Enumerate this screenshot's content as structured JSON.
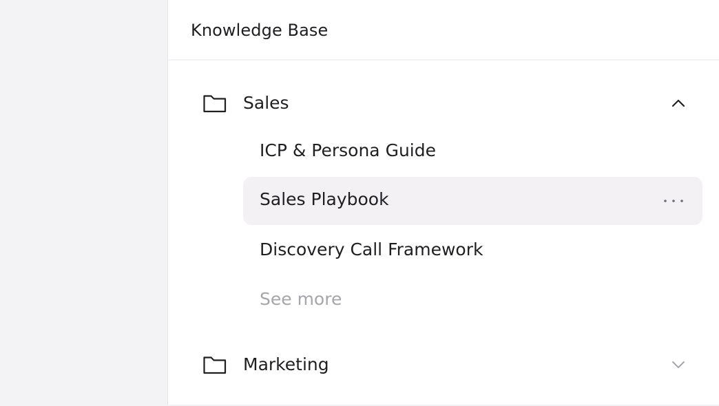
{
  "knowledge_base": {
    "title": "Knowledge Base",
    "folders": [
      {
        "label": "Sales",
        "icon": "folder-icon",
        "state": "expanded",
        "chevron_icon": "chevron-up-icon",
        "items": [
          {
            "label": "ICP & Persona Guide"
          },
          {
            "label": "Sales Playbook",
            "active": true,
            "menu_icon": "more-horizontal-icon"
          },
          {
            "label": "Discovery Call Framework"
          }
        ],
        "see_more": "See more"
      },
      {
        "label": "Marketing",
        "icon": "folder-icon",
        "state": "collapsed",
        "chevron_icon": "chevron-down-icon"
      }
    ]
  },
  "colors": {
    "background": "#f3f2f4",
    "panel": "#ffffff",
    "active_row": "#f3f1f4",
    "text": "#1f1f22",
    "muted_text": "#a6a5aa"
  }
}
